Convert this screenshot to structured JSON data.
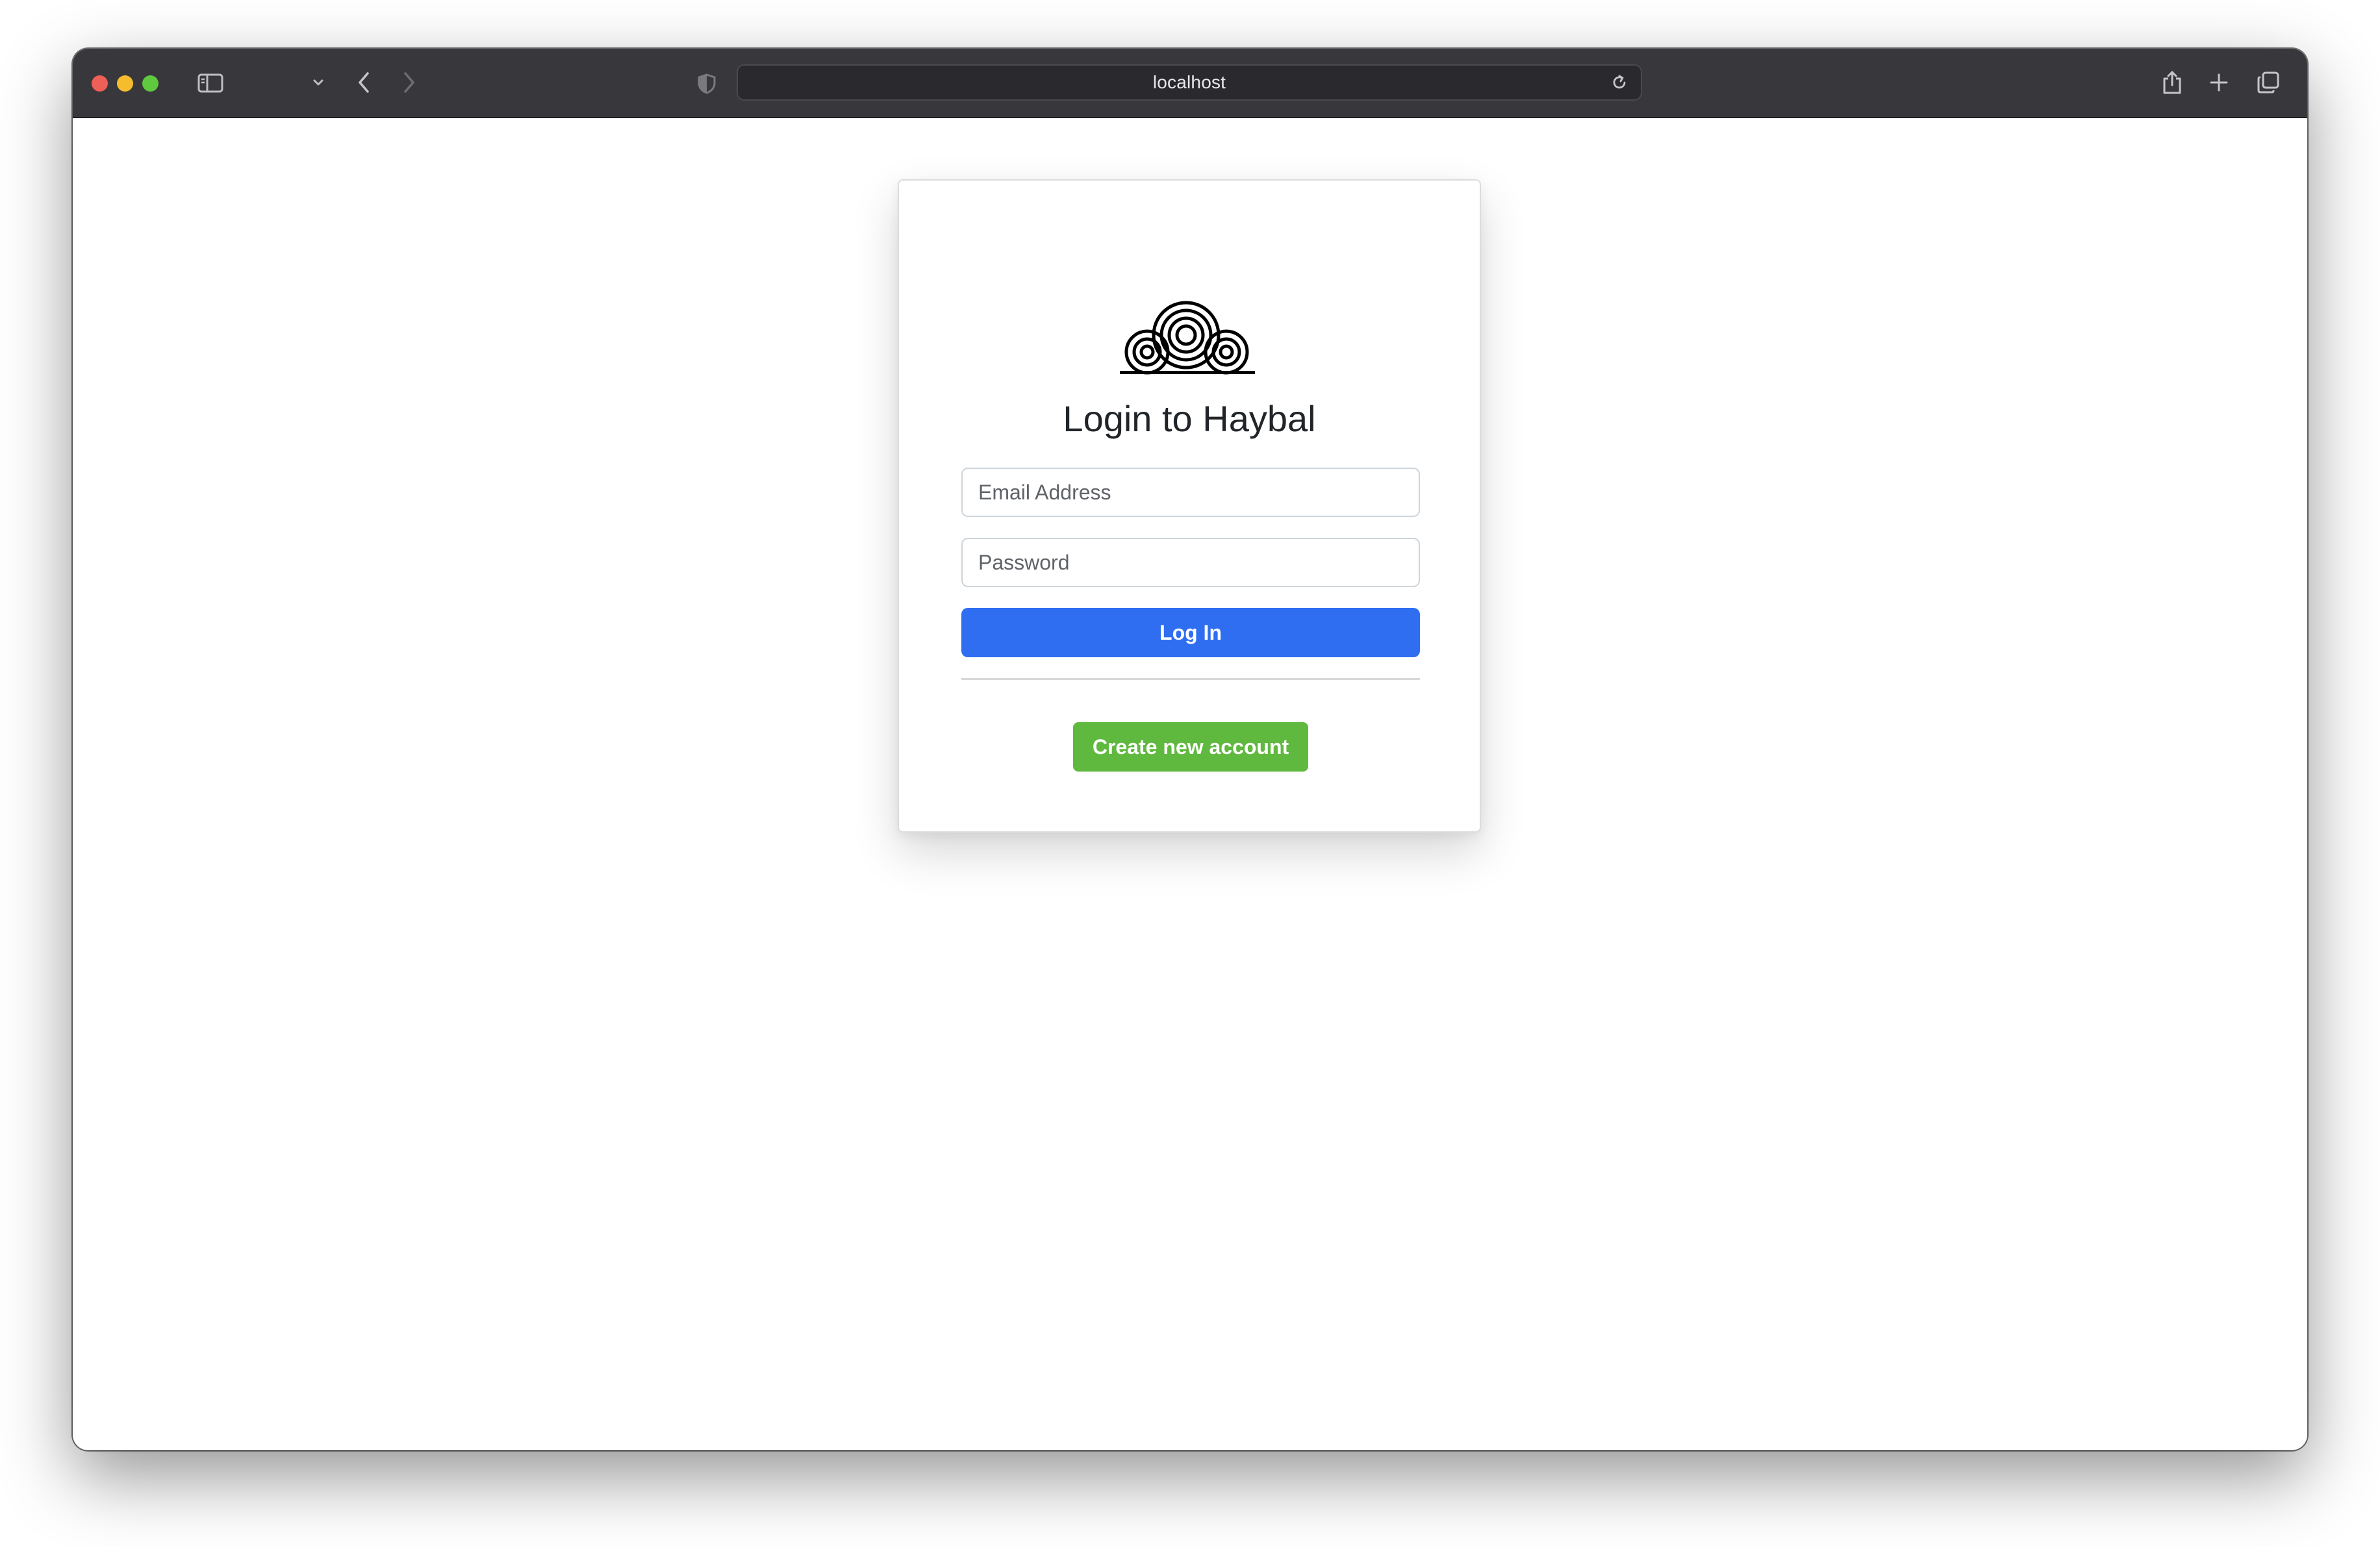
{
  "browser": {
    "url": "localhost",
    "icons": {
      "sidebar": "sidebar-icon",
      "sidebar_menu": "chevron-down-icon",
      "back": "back-icon",
      "forward": "forward-icon",
      "privacy": "shield-icon",
      "reload": "reload-icon",
      "share": "share-icon",
      "new_tab": "plus-icon",
      "tabs": "tab-overview-icon"
    }
  },
  "login": {
    "logo_icon": "hay-bale-logo-icon",
    "title": "Login to Haybal",
    "email_placeholder": "Email Address",
    "email_value": "",
    "password_placeholder": "Password",
    "password_value": "",
    "login_label": "Log In",
    "create_label": "Create new account"
  },
  "colors": {
    "primary": "#2f6ef0",
    "success": "#5fb93e",
    "toolbar": "#38373b",
    "traffic_close": "#ee5f57",
    "traffic_minimize": "#f5bd2e",
    "traffic_zoom": "#5fc93f"
  }
}
